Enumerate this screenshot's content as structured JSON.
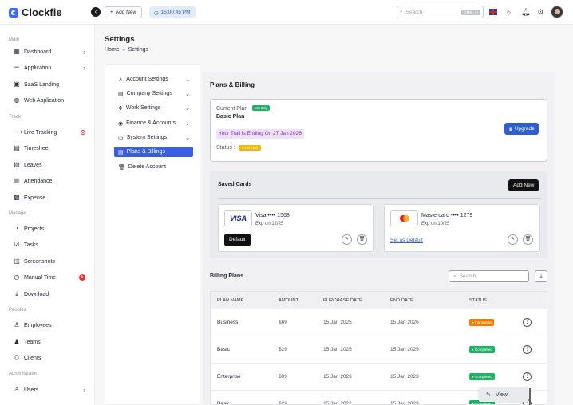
{
  "app": {
    "name": "Clockfie"
  },
  "header": {
    "add_new_label": "Add New",
    "clock_time": "15:00:45 PM",
    "search_placeholder": "Search",
    "search_shortcut": "CTRL + /"
  },
  "sidebar": {
    "sections": [
      {
        "label": "Main",
        "items": [
          {
            "label": "Dashboard",
            "icon": "dashboard-icon",
            "chevron": true
          },
          {
            "label": "Application",
            "icon": "application-icon",
            "chevron": true
          },
          {
            "label": "SaaS Landing",
            "icon": "saas-icon"
          },
          {
            "label": "Web Application",
            "icon": "web-icon"
          }
        ]
      },
      {
        "label": "Track",
        "items": [
          {
            "label": "Live Tracking",
            "icon": "live-tracking-icon",
            "indicator": "record"
          },
          {
            "label": "Timesheet",
            "icon": "timesheet-icon"
          },
          {
            "label": "Leaves",
            "icon": "leaves-icon"
          },
          {
            "label": "Attendance",
            "icon": "attendance-icon"
          },
          {
            "label": "Expense",
            "icon": "expense-icon"
          }
        ]
      },
      {
        "label": "Manage",
        "items": [
          {
            "label": "Projects",
            "icon": "projects-icon"
          },
          {
            "label": "Tasks",
            "icon": "tasks-icon"
          },
          {
            "label": "Screenshots",
            "icon": "screenshots-icon"
          },
          {
            "label": "Manual Time",
            "icon": "manual-time-icon",
            "badge": "5"
          },
          {
            "label": "Download",
            "icon": "download-icon"
          }
        ]
      },
      {
        "label": "Peoples",
        "items": [
          {
            "label": "Employees",
            "icon": "employees-icon"
          },
          {
            "label": "Teams",
            "icon": "teams-icon"
          },
          {
            "label": "Clients",
            "icon": "clients-icon"
          }
        ]
      },
      {
        "label": "Administrator",
        "items": [
          {
            "label": "Users",
            "icon": "users-icon",
            "chevron": true
          }
        ]
      }
    ]
  },
  "page": {
    "title": "Settings",
    "breadcrumb": [
      "Home",
      "Settings"
    ]
  },
  "settings_menu": [
    {
      "label": "Account Settings",
      "chevron": true
    },
    {
      "label": "Company Settings",
      "chevron": true
    },
    {
      "label": "Work Settings",
      "chevron": true
    },
    {
      "label": "Finance & Accounts",
      "chevron": true
    },
    {
      "label": "System Settings",
      "chevron": true
    },
    {
      "label": "Plans & Billings",
      "active": true
    },
    {
      "label": "Delete Account"
    }
  ],
  "plans": {
    "title": "Plans & Billing",
    "current_plan_label": "Current Plan",
    "cycle_badge": "Monthly",
    "plan_name": "Basic Plan",
    "trail_text": "Your Trail is Ending On 27 Jan 2026",
    "status_label": "Status :",
    "status_value": "On Trail",
    "upgrade_label": "Upgrade"
  },
  "saved_cards": {
    "title": "Saved Cards",
    "add_new_label": "Add New",
    "cards": [
      {
        "brand_text": "VISA",
        "name": "Visa •••• 1568",
        "expiry": "Exp on 12/25",
        "default_label": "Default"
      },
      {
        "name": "Mastercard •••• 1279",
        "expiry": "Exp on 10/25",
        "set_default_label": "Set as Default"
      }
    ]
  },
  "billing": {
    "title": "Billing Plans",
    "search_placeholder": "Search",
    "columns": [
      "PLAN NAME",
      "AMOUNT",
      "PURCHASE DATE",
      "END DATE",
      "STATUS"
    ],
    "rows": [
      {
        "plan": "Business",
        "amount": "$69",
        "purchase": "15 Jan 2025",
        "end": "15 Jan 2026",
        "status": "Inprogress",
        "status_color": "#f57c00"
      },
      {
        "plan": "Basic",
        "amount": "$29",
        "purchase": "15 Jan 2025",
        "end": "15 Jan 2025",
        "status": "Completed",
        "status_color": "#1db265"
      },
      {
        "plan": "Enterprise",
        "amount": "$99",
        "purchase": "15 Jan 2023",
        "end": "15 Jan 2023",
        "status": "Completed",
        "status_color": "#1db265"
      },
      {
        "plan": "Basic",
        "amount": "$29",
        "purchase": "15 Jan 2022",
        "end": "15 Jan 2023",
        "status": "Completed",
        "status_color": "#1db265"
      }
    ],
    "row_menu": {
      "view_label": "View"
    }
  },
  "colors": {
    "accent": "#3b5fe0",
    "success": "#1db265",
    "warning": "#f5b70a",
    "danger": "#e33333"
  }
}
